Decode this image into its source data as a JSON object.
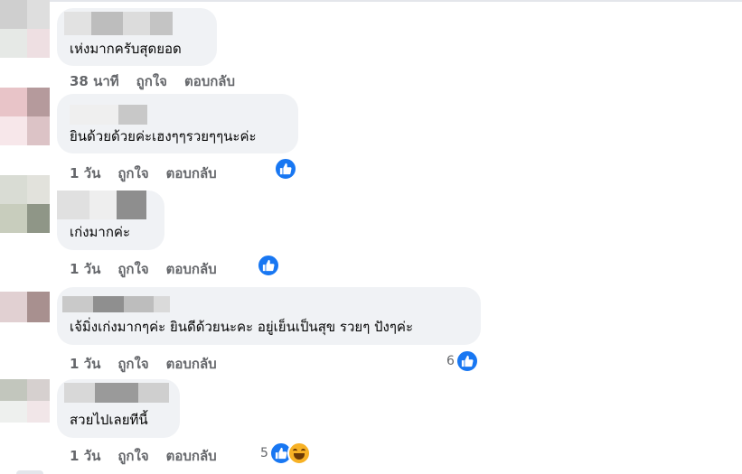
{
  "comments": [
    {
      "text": "เห่งมากครับสุดยอด",
      "time": "38 นาที",
      "like": "ถูกใจ",
      "reply": "ตอบกลับ",
      "reactions": null
    },
    {
      "text": "ยินด้วยด้วยค่ะเฮงๆๆรวยๆๆนะค่ะ",
      "time": "1 วัน",
      "like": "ถูกใจ",
      "reply": "ตอบกลับ",
      "reactions": {
        "icons": [
          "like-icon"
        ]
      }
    },
    {
      "text": "เก่งมากค่ะ",
      "time": "1 วัน",
      "like": "ถูกใจ",
      "reply": "ตอบกลับ",
      "reactions": {
        "icons": [
          "like-icon"
        ]
      }
    },
    {
      "text": "เจ้มิ่งเก่งมากๆค่ะ ยินดีด้วยนะคะ อยู่เย็นเป็นสุข รวยๆ ปังๆค่ะ",
      "time": "1 วัน",
      "like": "ถูกใจ",
      "reply": "ตอบกลับ",
      "reactions": {
        "count": "6",
        "icons": [
          "like-icon"
        ]
      }
    },
    {
      "text": "สวยไปเลยทีนี้",
      "time": "1 วัน",
      "like": "ถูกใจ",
      "reply": "ตอบกลับ",
      "reactions": {
        "count": "5",
        "icons": [
          "like-icon",
          "haha-icon"
        ]
      }
    }
  ],
  "colors": {
    "like": "#1877f2",
    "haha": "#f7b125",
    "bubble": "#f0f2f5",
    "meta": "#65676b"
  }
}
